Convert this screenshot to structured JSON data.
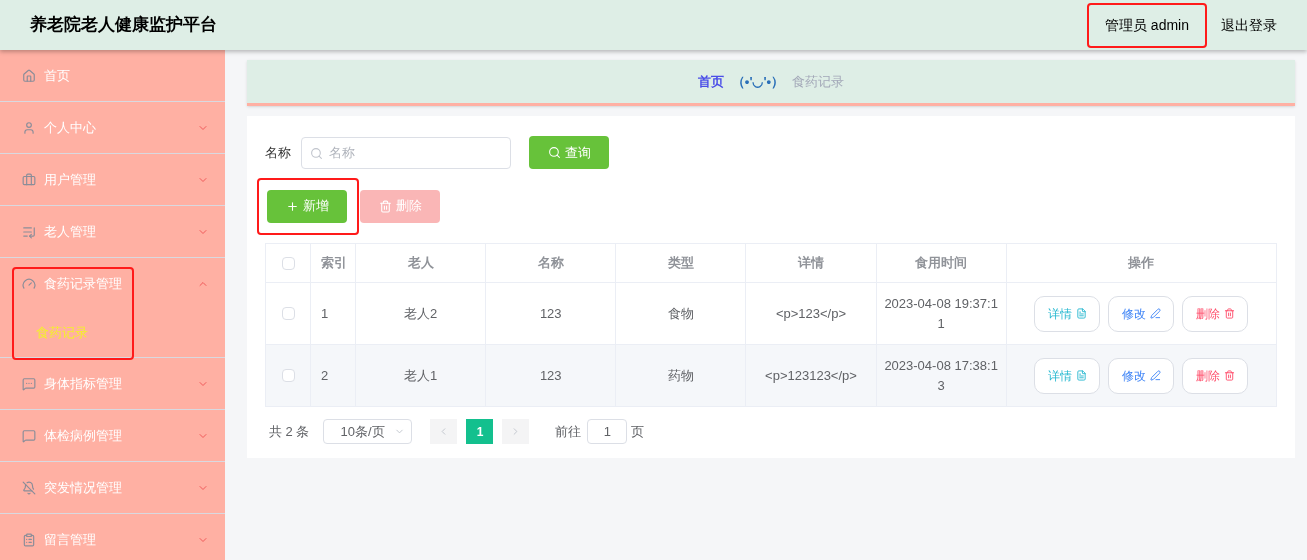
{
  "header": {
    "title": "养老院老人健康监护平台",
    "user": "管理员 admin",
    "user_highlighted": true,
    "logout": "退出登录"
  },
  "sidebar": {
    "items": [
      {
        "label": "首页",
        "expandable": false,
        "highlighted": false
      },
      {
        "label": "个人中心",
        "expandable": true,
        "expanded": false,
        "highlighted": false
      },
      {
        "label": "用户管理",
        "expandable": true,
        "expanded": false,
        "highlighted": false
      },
      {
        "label": "老人管理",
        "expandable": true,
        "expanded": false,
        "highlighted": false
      },
      {
        "label": "食药记录管理",
        "expandable": true,
        "expanded": true,
        "highlighted": true,
        "children": [
          {
            "label": "食药记录",
            "selected": true
          }
        ]
      },
      {
        "label": "身体指标管理",
        "expandable": true,
        "expanded": false,
        "highlighted": false
      },
      {
        "label": "体检病例管理",
        "expandable": true,
        "expanded": false,
        "highlighted": false
      },
      {
        "label": "突发情况管理",
        "expandable": true,
        "expanded": false,
        "highlighted": false
      },
      {
        "label": "留言管理",
        "expandable": true,
        "expanded": false,
        "highlighted": false
      }
    ]
  },
  "breadcrumb": {
    "home": "首页",
    "separator": "（•'◡'•）",
    "current": "食药记录"
  },
  "search": {
    "label": "名称",
    "placeholder": "名称",
    "button": "查询"
  },
  "actions": [
    {
      "label": "新增",
      "kind": "add",
      "disabled": false,
      "highlighted": true
    },
    {
      "label": "删除",
      "kind": "delete",
      "disabled": true,
      "highlighted": false
    }
  ],
  "table": {
    "all_checked": false,
    "columns": [
      "索引",
      "老人",
      "名称",
      "类型",
      "详情",
      "食用时间",
      "操作"
    ],
    "rows": [
      {
        "checked": false,
        "cells": [
          "1",
          "老人2",
          "123",
          "食物",
          "<p>123</p>",
          "2023-04-08 19:37:11"
        ],
        "actions": [
          {
            "label": "详情",
            "kind": "detail"
          },
          {
            "label": "修改",
            "kind": "edit"
          },
          {
            "label": "删除",
            "kind": "delete"
          }
        ]
      },
      {
        "checked": false,
        "cells": [
          "2",
          "老人1",
          "123",
          "药物",
          "<p>123123</p>",
          "2023-04-08 17:38:13"
        ],
        "actions": [
          {
            "label": "详情",
            "kind": "detail"
          },
          {
            "label": "修改",
            "kind": "edit"
          },
          {
            "label": "删除",
            "kind": "delete"
          }
        ]
      }
    ]
  },
  "pagination": {
    "total": "共 2 条",
    "page_size": "10条/页",
    "pages": [
      {
        "label": "1",
        "selected": true
      }
    ],
    "goto_label": "前往",
    "goto_value": "1",
    "page_suffix": "页"
  }
}
